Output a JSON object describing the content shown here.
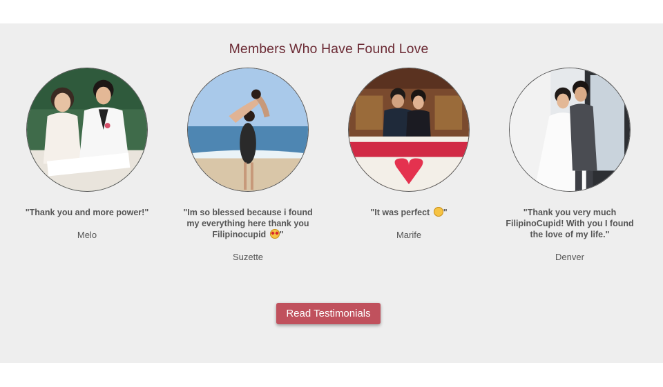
{
  "section": {
    "title": "Members Who Have Found Love",
    "background": "#eeeeee",
    "title_color": "#6b2a34"
  },
  "testimonials": [
    {
      "quote": "\"Thank you and more power!\"",
      "name": "Melo",
      "emoji": ""
    },
    {
      "quote": "\"Im so blessed because i found my everything here thank you Filipinocupid",
      "quote_end": "\"",
      "name": "Suzette",
      "emoji": "star-struck-emoji"
    },
    {
      "quote": "\"It was perfect",
      "quote_end": "\"",
      "name": "Marife",
      "emoji": "smiling-blush-emoji"
    },
    {
      "quote": "\"Thank you very much FilipinoCupid! With you I found the love of my life.\"",
      "name": "Denver",
      "emoji": ""
    }
  ],
  "cta": {
    "label": "Read Testimonials",
    "color": "#c0515d"
  }
}
